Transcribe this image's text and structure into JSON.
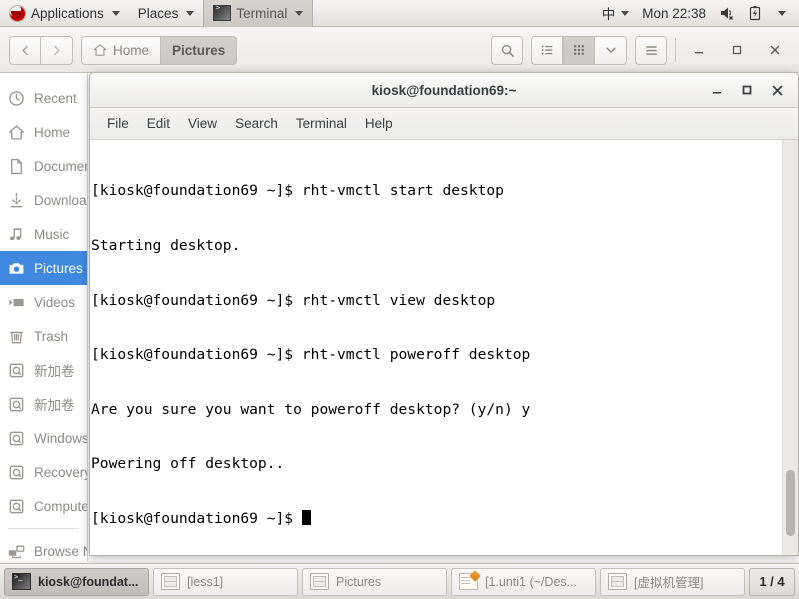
{
  "top_panel": {
    "logo_icon": "redhat-logo-icon",
    "applications_label": "Applications",
    "places_label": "Places",
    "active_window_label": "Terminal",
    "tray": {
      "input_method": "中",
      "clock": "Mon 22:38",
      "volume_icon": "speaker-muted-icon",
      "battery_icon": "battery-icon",
      "dropdown_icon": "chevron-down-icon"
    }
  },
  "file_manager": {
    "nav": {
      "back_icon": "chevron-left-icon",
      "forward_icon": "chevron-right-icon"
    },
    "breadcrumb": [
      {
        "label": "Home",
        "icon": "home-icon",
        "current": false
      },
      {
        "label": "Pictures",
        "icon": "",
        "current": true
      }
    ],
    "toolbar": {
      "search_icon": "search-icon",
      "list_view_icon": "list-view-icon",
      "grid_view_icon": "grid-view-icon",
      "view_options_icon": "chevron-down-icon",
      "menu_icon": "hamburger-menu-icon",
      "minimize_icon": "minimize-icon",
      "maximize_icon": "maximize-icon",
      "close_icon": "close-icon"
    },
    "sidebar": {
      "items": [
        {
          "label": "Recent",
          "icon": "clock-icon",
          "selected": false
        },
        {
          "label": "Home",
          "icon": "home-icon",
          "selected": false
        },
        {
          "label": "Documents",
          "icon": "document-icon",
          "selected": false
        },
        {
          "label": "Downloads",
          "icon": "download-icon",
          "selected": false
        },
        {
          "label": "Music",
          "icon": "music-note-icon",
          "selected": false
        },
        {
          "label": "Pictures",
          "icon": "camera-icon",
          "selected": true
        },
        {
          "label": "Videos",
          "icon": "video-icon",
          "selected": false
        },
        {
          "label": "Trash",
          "icon": "trash-icon",
          "selected": false
        }
      ],
      "drives": [
        {
          "label": "新加卷",
          "icon": "drive-icon"
        },
        {
          "label": "新加卷",
          "icon": "drive-icon"
        },
        {
          "label": "Windows",
          "icon": "drive-icon"
        },
        {
          "label": "Recovery",
          "icon": "drive-icon"
        },
        {
          "label": "Computer",
          "icon": "drive-icon"
        }
      ],
      "network": [
        {
          "label": "Browse Network",
          "icon": "network-icon"
        }
      ]
    }
  },
  "terminal": {
    "title": "kiosk@foundation69:~",
    "window_controls": {
      "minimize_icon": "minimize-icon",
      "maximize_icon": "maximize-icon",
      "close_icon": "close-icon"
    },
    "menus": [
      "File",
      "Edit",
      "View",
      "Search",
      "Terminal",
      "Help"
    ],
    "lines": [
      "[kiosk@foundation69 ~]$ rht-vmctl start desktop",
      "Starting desktop.",
      "[kiosk@foundation69 ~]$ rht-vmctl view desktop",
      "[kiosk@foundation69 ~]$ rht-vmctl poweroff desktop",
      "Are you sure you want to poweroff desktop? (y/n) y",
      "Powering off desktop..",
      "[kiosk@foundation69 ~]$ "
    ],
    "prompt_line": "[kiosk@foundation69 ~]$ ",
    "scrollbar": "vertical-scrollbar"
  },
  "taskbar": {
    "tasks": [
      {
        "label": "kiosk@foundat...",
        "icon": "terminal-icon",
        "active": true
      },
      {
        "label": "[less1]",
        "icon": "file-manager-icon",
        "active": false
      },
      {
        "label": "Pictures",
        "icon": "file-manager-icon",
        "active": false
      },
      {
        "label": "[1.unti1 (~/Des...",
        "icon": "notepad-icon",
        "active": false
      },
      {
        "label": "[虚拟机管理]",
        "icon": "file-manager-icon",
        "active": false
      }
    ],
    "workspace_indicator": "1 / 4"
  },
  "colors": {
    "selection_blue": "#3f8ae0",
    "panel_gray": "#e6e4e1",
    "terminal_bg": "#ffffff",
    "terminal_fg": "#000000"
  }
}
